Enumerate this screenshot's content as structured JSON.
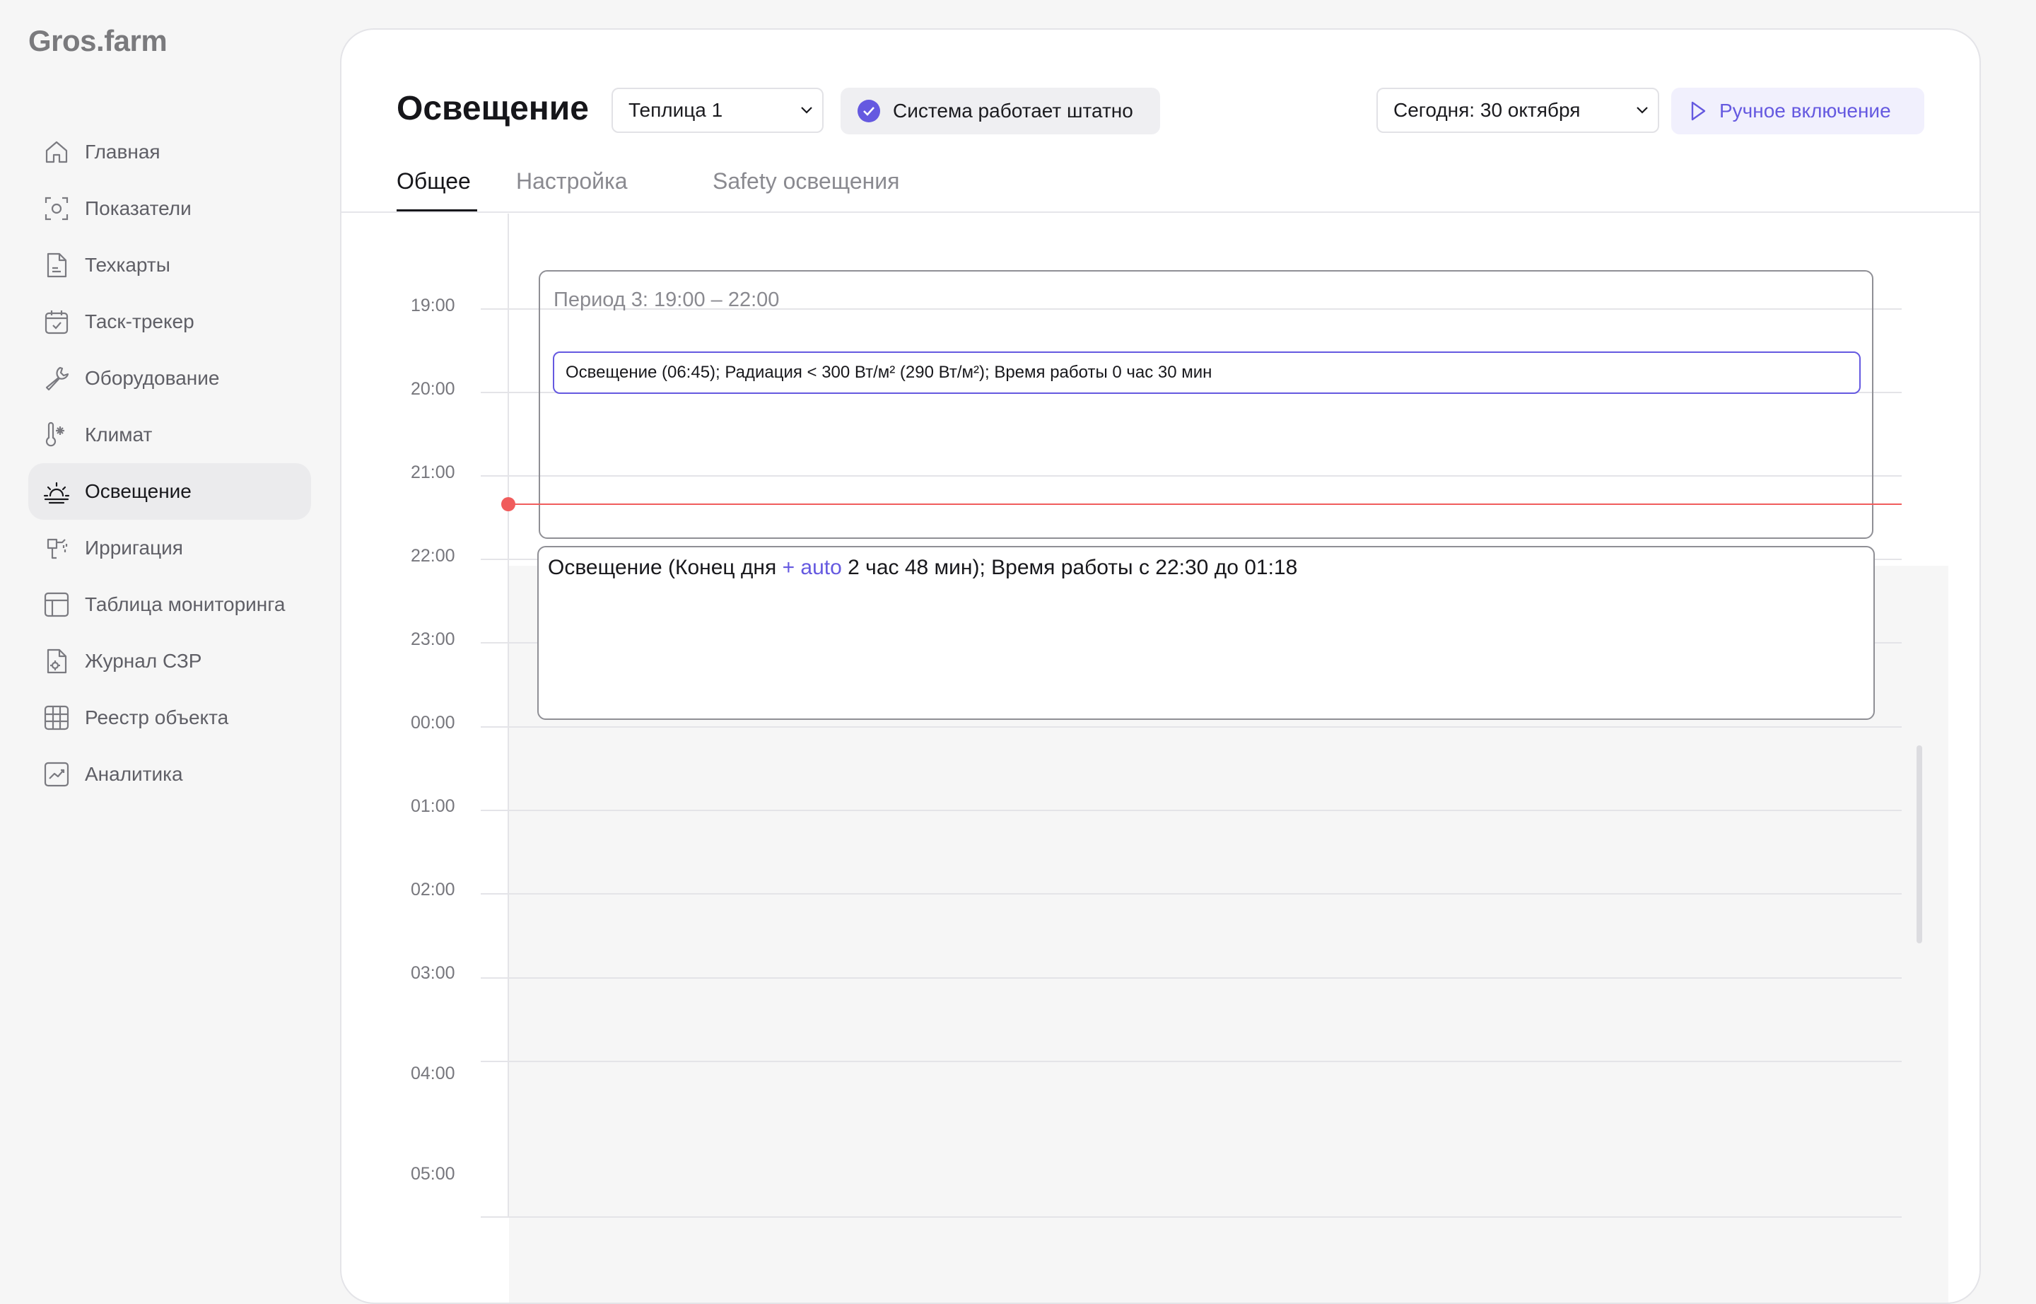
{
  "app": {
    "logo": "Gros.farm"
  },
  "sidebar": {
    "items": [
      {
        "label": "Главная",
        "icon": "home-icon"
      },
      {
        "label": "Показатели",
        "icon": "metrics-icon"
      },
      {
        "label": "Техкарты",
        "icon": "document-icon"
      },
      {
        "label": "Таск-трекер",
        "icon": "calendar-check-icon"
      },
      {
        "label": "Оборудование",
        "icon": "wrench-icon"
      },
      {
        "label": "Климат",
        "icon": "thermometer-icon"
      },
      {
        "label": "Освещение",
        "icon": "sunrise-icon",
        "active": true
      },
      {
        "label": "Ирригация",
        "icon": "irrigation-icon"
      },
      {
        "label": "Таблица мониторинга",
        "icon": "table-icon"
      },
      {
        "label": "Журнал СЗР",
        "icon": "journal-icon"
      },
      {
        "label": "Реестр объекта",
        "icon": "grid-icon"
      },
      {
        "label": "Аналитика",
        "icon": "analytics-icon"
      }
    ]
  },
  "header": {
    "title": "Освещение",
    "greenhouse_select": "Теплица 1",
    "status": "Система работает штатно",
    "date_select": "Сегодня: 30 октября",
    "manual_button": "Ручное включение"
  },
  "tabs": [
    {
      "label": "Общее",
      "active": true
    },
    {
      "label": "Настройка"
    },
    {
      "label": "Safety освещения"
    }
  ],
  "timeline": {
    "times": [
      "19:00",
      "20:00",
      "21:00",
      "22:00",
      "23:00",
      "00:00",
      "01:00",
      "02:00",
      "03:00",
      "04:00",
      "05:00"
    ],
    "period": {
      "title": "Период 3: 19:00 – 22:00",
      "event": "Освещение (06:45); Радиация < 300 Вт/м² (290  Вт/м²); Время работы 0 час 30 мин"
    },
    "end_of_day": {
      "prefix": "Освещение (Конец дня ",
      "auto": "+ auto",
      "suffix": " 2 час 48 мин); Время работы с 22:30 до 01:18"
    }
  },
  "colors": {
    "accent": "#6559e0",
    "now_line": "#f05c5c"
  }
}
